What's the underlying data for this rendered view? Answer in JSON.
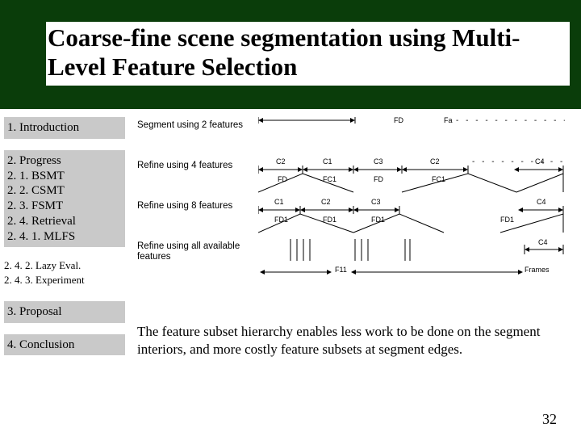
{
  "title": "Coarse-fine scene segmentation using Multi-Level Feature Selection",
  "sidebar": {
    "s1": "1. Introduction",
    "s2_header": "2. Progress",
    "s21": "2. 1. BSMT",
    "s22": "2. 2. CSMT",
    "s23": "2. 3. FSMT",
    "s24": "2. 4. Retrieval",
    "s241": "2. 4. 1. MLFS",
    "s242": "2. 4. 2. Lazy Eval.",
    "s243": "2. 4. 3. Experiment",
    "s3": "3. Proposal",
    "s4": "4. Conclusion"
  },
  "diagram": {
    "row1_label": "Segment using 2 features",
    "row2_label": "Refine using 4 features",
    "row3_label": "Refine using 8 features",
    "row4_label": "Refine using all available features",
    "C1": "C1",
    "C2": "C2",
    "C3": "C3",
    "C4": "C4",
    "FD": "FD",
    "FC1": "FC1",
    "FD1": "FD1",
    "Fa": "Fa",
    "F11": "F11",
    "Frames": "Frames",
    "ellipsis": "- - - - - - - - - - - - - -"
  },
  "caption": "The feature subset hierarchy enables less work to be done on the segment interiors, and more costly feature subsets at segment edges.",
  "page_number": "32"
}
